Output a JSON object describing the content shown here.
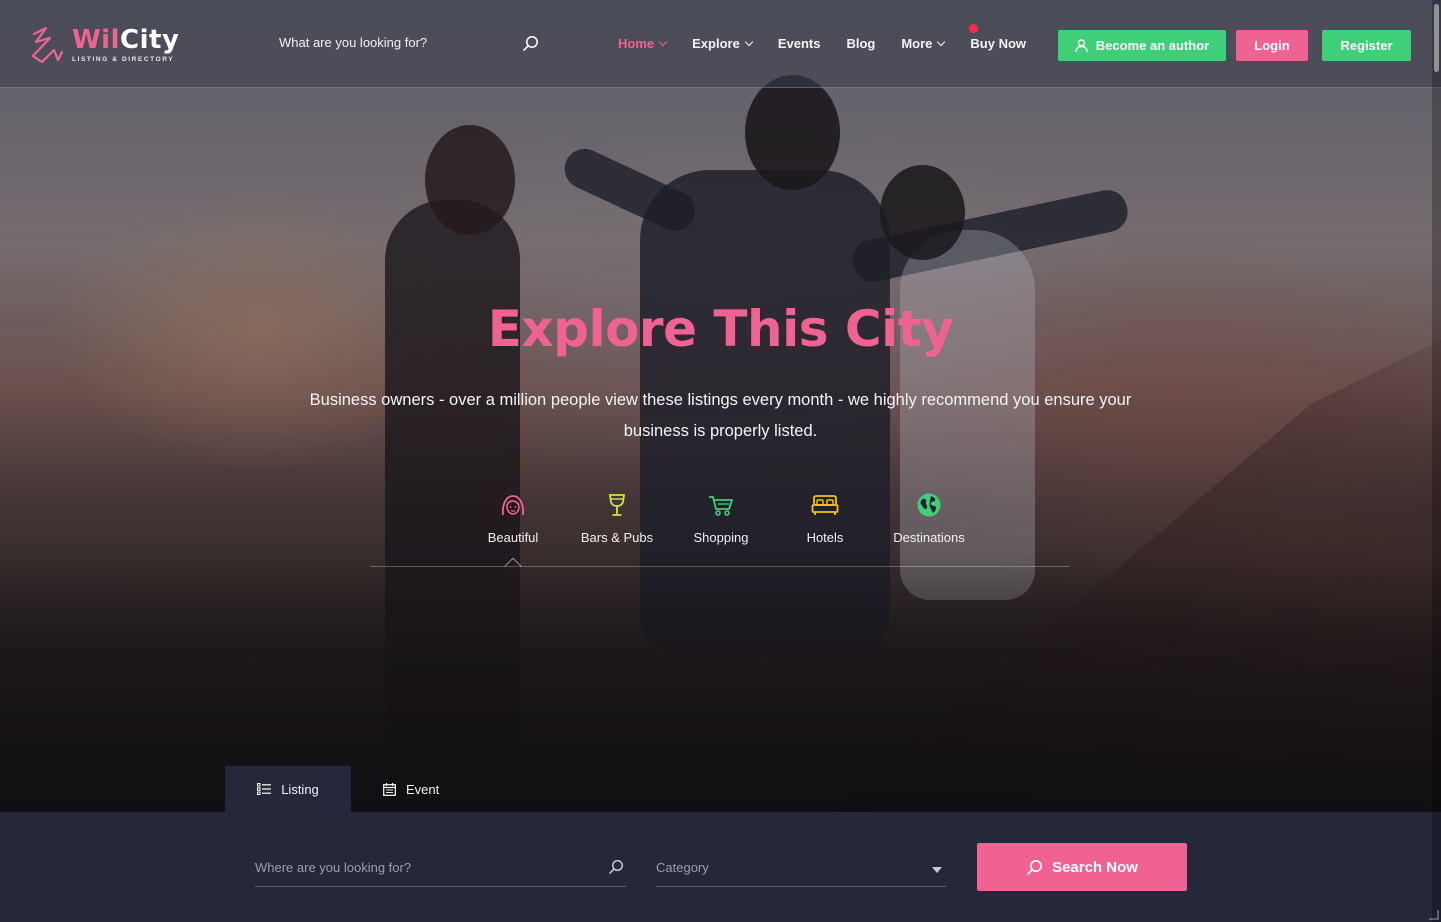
{
  "brand": {
    "name_part1": "Wil",
    "name_part2": "City",
    "tagline": "LISTING & DIRECTORY",
    "accent_color": "#f06292",
    "green_color": "#3ecf78"
  },
  "header": {
    "search_placeholder": "What are you looking for?",
    "nav": [
      {
        "label": "Home",
        "has_dropdown": true,
        "active": true
      },
      {
        "label": "Explore",
        "has_dropdown": true,
        "active": false
      },
      {
        "label": "Events",
        "has_dropdown": false,
        "active": false
      },
      {
        "label": "Blog",
        "has_dropdown": false,
        "active": false
      },
      {
        "label": "More",
        "has_dropdown": true,
        "active": false
      },
      {
        "label": "Buy Now",
        "has_dropdown": false,
        "active": false
      }
    ],
    "become_author_label": "Become an author",
    "login_label": "Login",
    "register_label": "Register"
  },
  "hero": {
    "title": "Explore This City",
    "subtitle": "Business owners - over a million people view these listings every month - we highly recommend you ensure your business is properly listed.",
    "categories": [
      {
        "label": "Beautiful",
        "icon": "face-icon",
        "color": "#f06292"
      },
      {
        "label": "Bars & Pubs",
        "icon": "wine-glass-icon",
        "color": "#c6e84a"
      },
      {
        "label": "Shopping",
        "icon": "shopping-cart-icon",
        "color": "#3ecf78"
      },
      {
        "label": "Hotels",
        "icon": "bed-icon",
        "color": "#f5c518"
      },
      {
        "label": "Destinations",
        "icon": "globe-icon",
        "color": "#3ecf78"
      }
    ],
    "selected_category": "Beautiful"
  },
  "search_tabs": [
    {
      "label": "Listing",
      "icon": "list-icon",
      "active": true
    },
    {
      "label": "Event",
      "icon": "calendar-icon",
      "active": false
    }
  ],
  "search_form": {
    "where_placeholder": "Where are you looking for?",
    "category_placeholder": "Category",
    "submit_label": "Search Now"
  }
}
